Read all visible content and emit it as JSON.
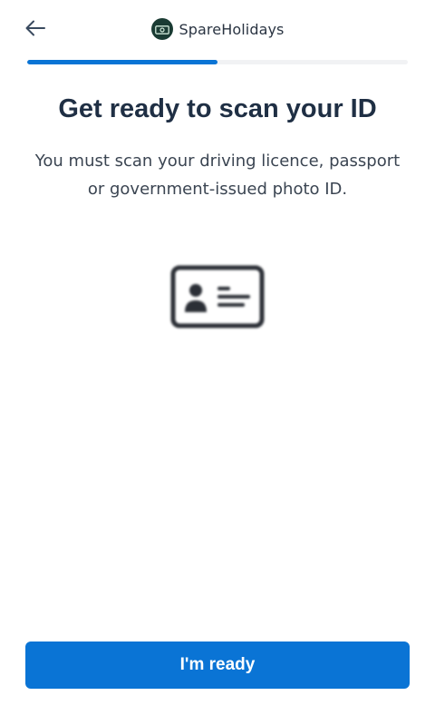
{
  "header": {
    "back_icon": "arrow-left-icon",
    "brand_logo_icon": "money-note-icon",
    "brand_name": "SpareHolidays",
    "brand_logo_color": "#1a3b33"
  },
  "progress": {
    "fraction": 0.5,
    "fill_color": "#0a74d5",
    "track_color": "#f1f2f4"
  },
  "main": {
    "title": "Get ready to scan your ID",
    "subtitle": "You must scan your driving licence, passport or government-issued photo ID.",
    "illustration_icon": "id-card-icon"
  },
  "footer": {
    "cta_label": "I'm ready",
    "cta_color": "#0a74d5"
  }
}
